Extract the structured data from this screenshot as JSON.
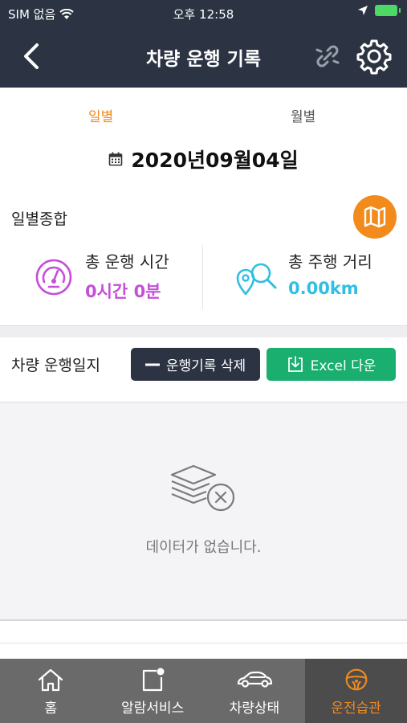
{
  "status_bar": {
    "carrier": "SIM 없음",
    "time": "오후 12:58"
  },
  "header": {
    "title": "차량 운행 기록"
  },
  "tabs": [
    {
      "label": "일별"
    },
    {
      "label": "월별"
    }
  ],
  "date": "2020년09월04일",
  "summary": {
    "title": "일별종합",
    "total_time": {
      "label": "총 운행 시간",
      "value": "0시간 0분"
    },
    "total_distance": {
      "label": "총 주행 거리",
      "value": "0.00km"
    }
  },
  "log": {
    "title": "차량 운행일지",
    "delete_label": "운행기록 삭제",
    "excel_label": "Excel 다운",
    "empty_text": "데이터가 없습니다."
  },
  "bottom_nav": [
    {
      "label": "홈",
      "icon": "home-icon"
    },
    {
      "label": "알람서비스",
      "icon": "alarm-icon"
    },
    {
      "label": "차량상태",
      "icon": "car-icon"
    },
    {
      "label": "운전습관",
      "icon": "steering-wheel-icon"
    }
  ],
  "colors": {
    "accent": "#f28a1c",
    "header": "#2c3444",
    "excel": "#1aae6f",
    "time": "#c54fd8",
    "distance": "#2fbfe3"
  }
}
